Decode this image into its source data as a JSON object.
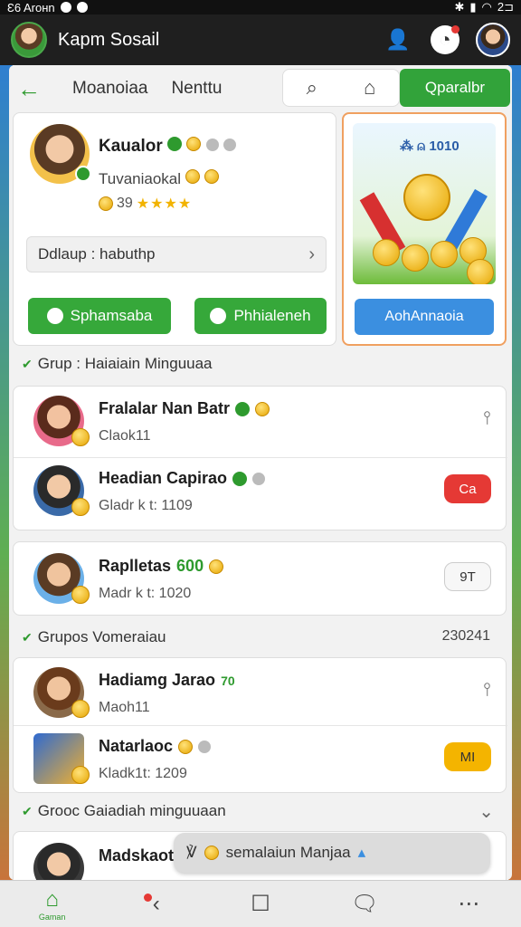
{
  "status_bar": {
    "left_text": "Ɛ6 Aroнn",
    "right_text": "2⊐"
  },
  "app_bar": {
    "title": "Kapm Sosail"
  },
  "nav": {
    "tab1": "Moanoiaa",
    "tab2": "Nenttu",
    "primary_button": "Qparalbr"
  },
  "profile": {
    "name": "Kaualor",
    "subtitle": "Tuvaniaokal",
    "score": "39",
    "stars": "★★★★",
    "status_field": "Ddlaup : habuthp",
    "button1": "Sphamsaba",
    "button2": "Phhialeneh"
  },
  "reward": {
    "top_label": "1010",
    "button": "AohAnnaoia"
  },
  "groups": [
    {
      "title": "Grup : Haiaiain Minguuaa"
    },
    {
      "title": "Grupos Vomeraiau",
      "right_value": "230241"
    },
    {
      "title": "Grooc Gaiadiah minguuaan"
    }
  ],
  "list": [
    {
      "name": "Fralalar Nan Batr",
      "sub": "Claok11"
    },
    {
      "name": "Headian Capirao",
      "sub": "Gladr k t: 1109",
      "action": "Ca"
    },
    {
      "name": "Raplletas",
      "name_num": "600",
      "sub": "Madr k t: 1020",
      "action": "9T"
    },
    {
      "name": "Hadiamg Jarao",
      "name_num": "70",
      "sub": "Maoh11"
    },
    {
      "name": "Natarlaoc",
      "sub": "Kladk1t: 1209",
      "action": "MI"
    },
    {
      "name": "Madskaot"
    }
  ],
  "toast": {
    "text": "semalaiun Manjaa"
  },
  "bottom_nav": {
    "home_label": "Gaman"
  },
  "colors": {
    "accent_green": "#32a33a",
    "blue_button": "#3b8fe0",
    "red_pill": "#e53935",
    "yellow_pill": "#f4b400"
  }
}
